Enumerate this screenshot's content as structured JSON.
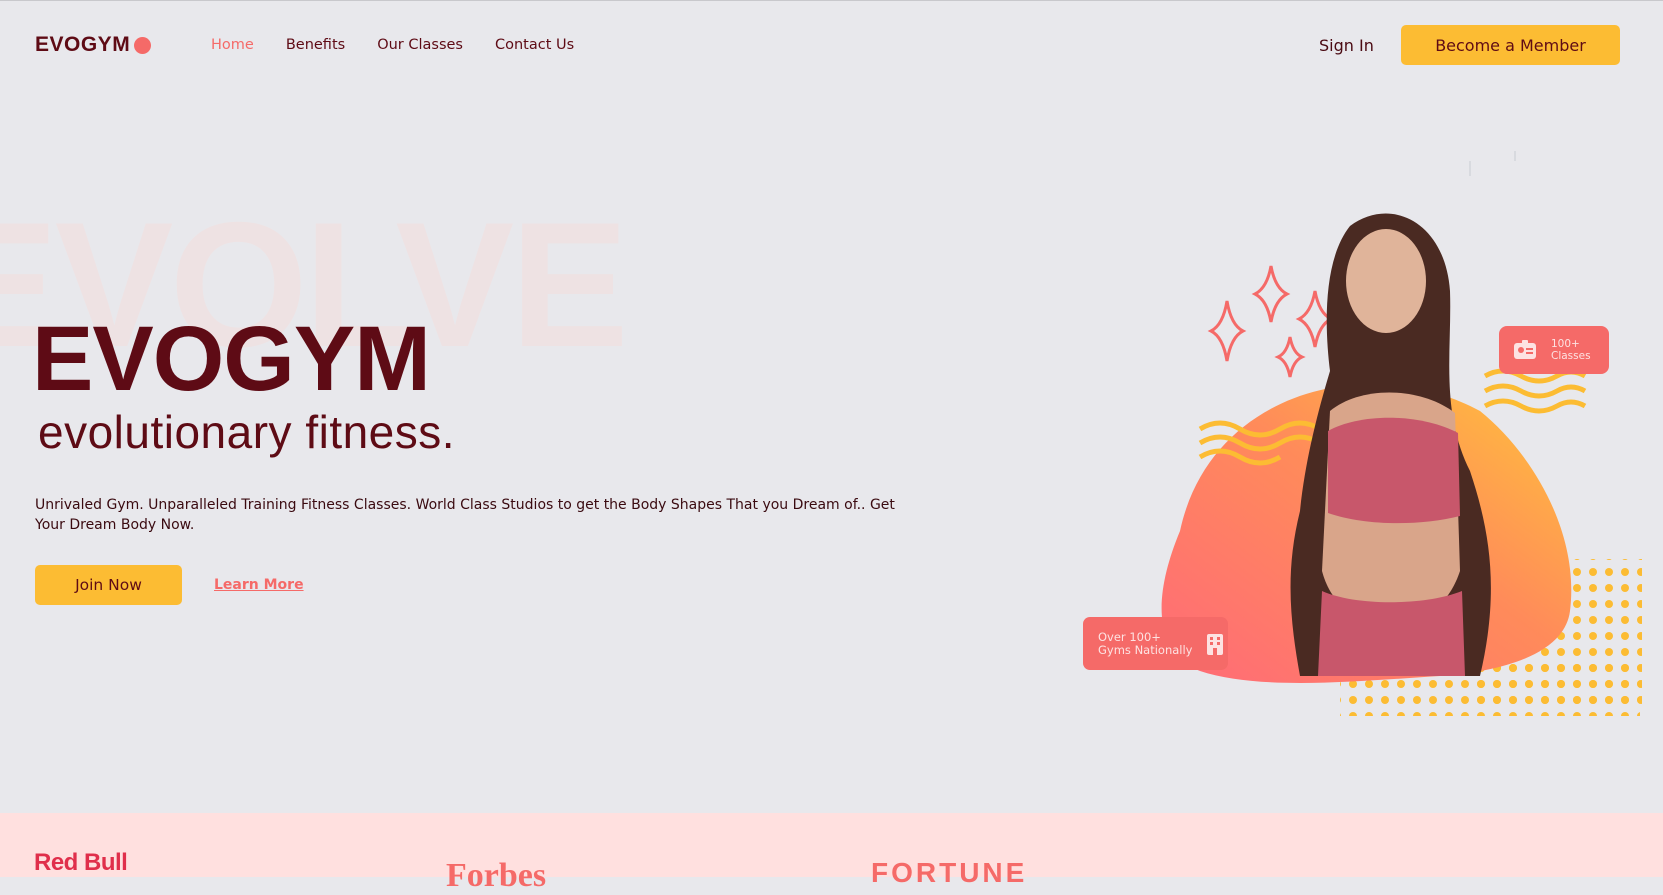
{
  "nav": {
    "logo": "EVOGYM",
    "links": [
      "Home",
      "Benefits",
      "Our Classes",
      "Contact Us"
    ],
    "sign_in": "Sign In",
    "cta": "Become a Member"
  },
  "hero": {
    "bg_word": "EVOLVE",
    "title": "EVOGYM",
    "subtitle": "evolutionary fitness.",
    "description": "Unrivaled Gym. Unparalleled Training Fitness Classes. World Class Studios to get the Body Shapes That you Dream of.. Get Your Dream Body Now.",
    "join_label": "Join Now",
    "learn_more_label": "Learn More"
  },
  "badges": {
    "classes_line1": "100+",
    "classes_line2": "Classes",
    "gyms_line1": "Over 100+",
    "gyms_line2": "Gyms Nationally"
  },
  "sponsors": [
    "Red Bull",
    "Forbes",
    "FORTUNE"
  ],
  "colors": {
    "brand_dark": "#5e0b15",
    "accent_coral": "#f56a68",
    "accent_yellow": "#fcbc33",
    "background": "#e8e8ec",
    "sponsor_strip": "#ffe0df"
  }
}
